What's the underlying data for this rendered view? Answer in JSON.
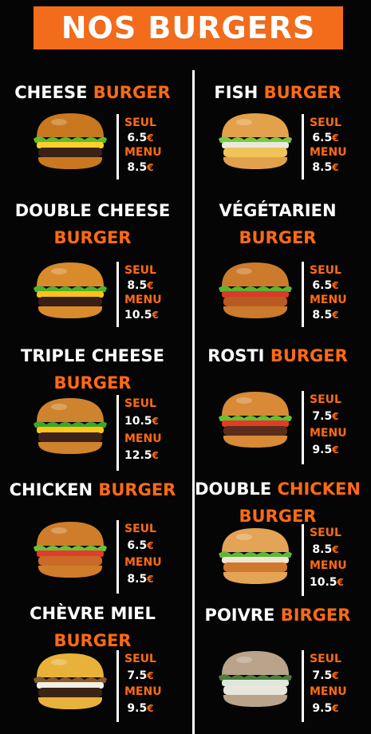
{
  "header": {
    "title": "NOS BURGERS"
  },
  "colors": {
    "accent": "#f26c1c",
    "background": "#050505",
    "text": "#ffffff"
  },
  "currency": "€",
  "items": [
    {
      "name_white": "CHEESE ",
      "name_orange": "BURGER",
      "line2": "",
      "seul_label": "SEUL",
      "seul_price": "6.5",
      "menu_label": "MENU",
      "menu_price": "8.5"
    },
    {
      "name_white": "FISH ",
      "name_orange": "BURGER",
      "line2": "",
      "seul_label": "SEUL",
      "seul_price": "6.5",
      "menu_label": "MENU",
      "menu_price": "8.5"
    },
    {
      "name_white": "DOUBLE CHEESE",
      "name_orange": "",
      "line2": "BURGER",
      "seul_label": "SEUL",
      "seul_price": "8.5",
      "menu_label": "MENU",
      "menu_price": "10.5"
    },
    {
      "name_white": "VÉGÉTARIEN",
      "name_orange": "",
      "line2": "BURGER",
      "seul_label": "SEUL",
      "seul_price": "6.5",
      "menu_label": "MENU",
      "menu_price": "8.5"
    },
    {
      "name_white": "TRIPLE CHEESE",
      "name_orange": "",
      "line2": "BURGER",
      "seul_label": "SEUL",
      "seul_price": "10.5",
      "menu_label": "MENU",
      "menu_price": "12.5"
    },
    {
      "name_white": "ROSTI ",
      "name_orange": "BURGER",
      "line2": "",
      "seul_label": "SEUL",
      "seul_price": "7.5",
      "menu_label": "MENU",
      "menu_price": "9.5"
    },
    {
      "name_white": "CHICKEN ",
      "name_orange": "BURGER",
      "line2": "",
      "seul_label": "SEUL",
      "seul_price": "6.5",
      "menu_label": "MENU",
      "menu_price": "8.5"
    },
    {
      "name_white": "DOUBLE ",
      "name_orange": "CHICKEN",
      "line2": "BURGER",
      "seul_label": "SEUL",
      "seul_price": "8.5",
      "menu_label": "MENU",
      "menu_price": "10.5"
    },
    {
      "name_white": "CHÈVRE MIEL",
      "name_orange": "",
      "line2": "BURGER",
      "seul_label": "SEUL",
      "seul_price": "7.5",
      "menu_label": "MENU",
      "menu_price": "9.5"
    },
    {
      "name_white": "POIVRE ",
      "name_orange": "BIRGER",
      "line2": "",
      "seul_label": "SEUL",
      "seul_price": "7.5",
      "menu_label": "MENU",
      "menu_price": "9.5"
    }
  ]
}
